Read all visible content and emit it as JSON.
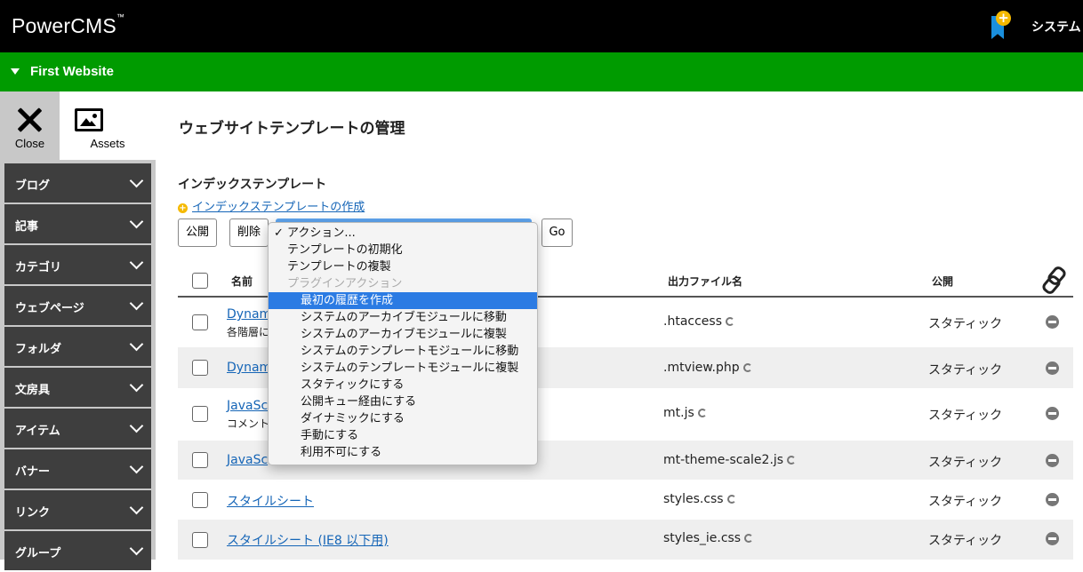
{
  "header": {
    "logo": "PowerCMS",
    "logo_tm": "™",
    "system_label": "システム",
    "accent_color": "#000000"
  },
  "site": {
    "name": "First Website",
    "color": "#009b00"
  },
  "left_tabs": {
    "close_label": "Close",
    "assets_label": "Assets"
  },
  "sidebar": {
    "items": [
      {
        "label": "ブログ"
      },
      {
        "label": "記事"
      },
      {
        "label": "カテゴリ"
      },
      {
        "label": "ウェブページ"
      },
      {
        "label": "フォルダ"
      },
      {
        "label": "文房具"
      },
      {
        "label": "アイテム"
      },
      {
        "label": "バナー"
      },
      {
        "label": "リンク"
      },
      {
        "label": "グループ"
      }
    ]
  },
  "main": {
    "page_title": "ウェブサイトテンプレートの管理",
    "section_title": "インデックステンプレート",
    "create_link": "インデックステンプレートの作成",
    "buttons": {
      "publish": "公開",
      "delete": "削除",
      "go": "Go"
    }
  },
  "action_dropdown": {
    "options": [
      {
        "label": "アクション...",
        "checked": true
      },
      {
        "label": "テンプレートの初期化"
      },
      {
        "label": "テンプレートの複製"
      },
      {
        "label": "プラグインアクション",
        "disabled": true
      },
      {
        "label": "最初の履歴を作成",
        "selected": true
      },
      {
        "label": "システムのアーカイブモジュールに移動"
      },
      {
        "label": "システムのアーカイブモジュールに複製"
      },
      {
        "label": "システムのテンプレートモジュールに移動"
      },
      {
        "label": "システムのテンプレートモジュールに複製"
      },
      {
        "label": "スタティックにする"
      },
      {
        "label": "公開キュー経由にする"
      },
      {
        "label": "ダイナミックにする"
      },
      {
        "label": "手動にする"
      },
      {
        "label": "利用不可にする"
      }
    ],
    "check_mark": "✓"
  },
  "table": {
    "headers": {
      "name": "名前",
      "output": "出力ファイル名",
      "publish": "公開"
    },
    "rows": [
      {
        "name": "Dynami",
        "desc": "各階層に",
        "output": ".htaccess",
        "publish": "スタティック"
      },
      {
        "name": "Dynami",
        "desc": "",
        "output": ".mtview.php",
        "publish": "スタティック"
      },
      {
        "name": "JavaSc",
        "desc": "コメント",
        "output": "mt.js",
        "publish": "スタティック"
      },
      {
        "name": "JavaSc",
        "desc": "",
        "output": "mt-theme-scale2.js",
        "publish": "スタティック"
      },
      {
        "name": "スタイルシート",
        "desc": "",
        "output": "styles.css",
        "publish": "スタティック"
      },
      {
        "name": "スタイルシート (IE8 以下用)",
        "desc": "",
        "output": "styles_ie.css",
        "publish": "スタティック"
      }
    ]
  }
}
